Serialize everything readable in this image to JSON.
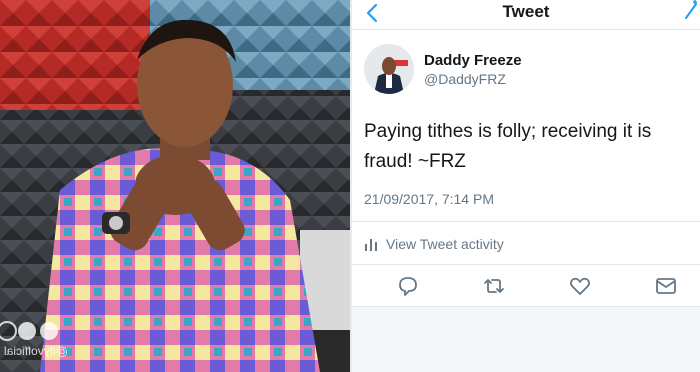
{
  "photo": {
    "watermark_handle": "@ifyvofficial"
  },
  "tweet": {
    "nav_title": "Tweet",
    "display_name": "Daddy Freeze",
    "handle": "@DaddyFRZ",
    "text": "Paying tithes is folly; receiving it is fraud! ~FRZ",
    "timestamp": "21/09/2017, 7:14 PM",
    "activity_label": "View Tweet activity",
    "accent_color": "#1da1f2",
    "icons": [
      "chevron-left-icon",
      "compose-icon",
      "reply-icon",
      "retweet-icon",
      "like-icon",
      "direct-message-icon",
      "analytics-bars-icon"
    ]
  }
}
